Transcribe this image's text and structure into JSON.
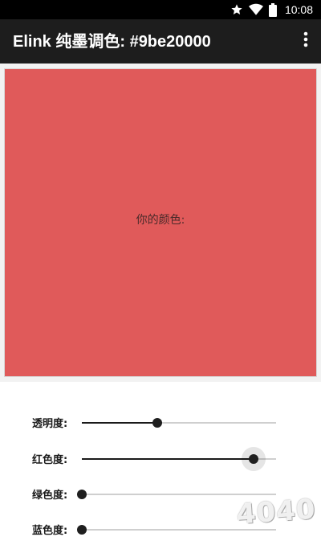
{
  "status_bar": {
    "time": "10:08",
    "icons": [
      "star-icon",
      "wifi-icon",
      "battery-icon"
    ]
  },
  "app_bar": {
    "title": "Elink 纯墨调色: #9be20000",
    "menu_icon": "more-vert-icon"
  },
  "preview": {
    "label": "你的颜色:",
    "color": "#e05a5a"
  },
  "sliders": [
    {
      "label": "透明度:",
      "value": 0.39,
      "active": false
    },
    {
      "label": "红色度:",
      "value": 0.886,
      "active": true
    },
    {
      "label": "绿色度:",
      "value": 0.0,
      "active": false
    },
    {
      "label": "蓝色度:",
      "value": 0.0,
      "active": false
    }
  ],
  "watermark": "4040"
}
